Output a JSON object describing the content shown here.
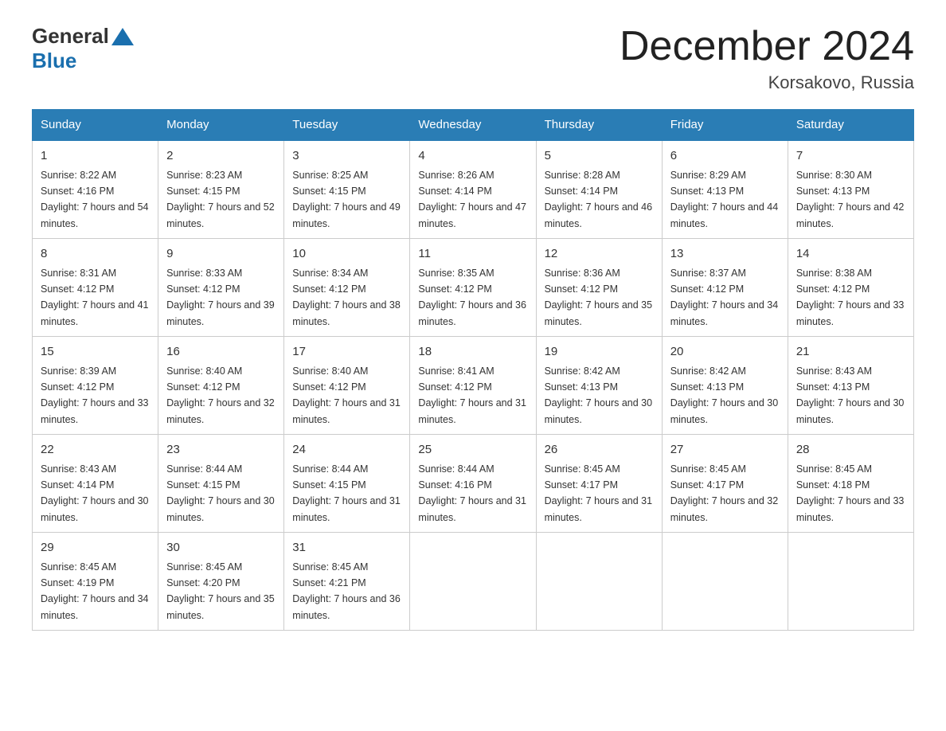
{
  "logo": {
    "general": "General",
    "blue": "Blue"
  },
  "title": "December 2024",
  "subtitle": "Korsakovo, Russia",
  "days_of_week": [
    "Sunday",
    "Monday",
    "Tuesday",
    "Wednesday",
    "Thursday",
    "Friday",
    "Saturday"
  ],
  "weeks": [
    [
      {
        "day": "1",
        "sunrise": "8:22 AM",
        "sunset": "4:16 PM",
        "daylight": "7 hours and 54 minutes."
      },
      {
        "day": "2",
        "sunrise": "8:23 AM",
        "sunset": "4:15 PM",
        "daylight": "7 hours and 52 minutes."
      },
      {
        "day": "3",
        "sunrise": "8:25 AM",
        "sunset": "4:15 PM",
        "daylight": "7 hours and 49 minutes."
      },
      {
        "day": "4",
        "sunrise": "8:26 AM",
        "sunset": "4:14 PM",
        "daylight": "7 hours and 47 minutes."
      },
      {
        "day": "5",
        "sunrise": "8:28 AM",
        "sunset": "4:14 PM",
        "daylight": "7 hours and 46 minutes."
      },
      {
        "day": "6",
        "sunrise": "8:29 AM",
        "sunset": "4:13 PM",
        "daylight": "7 hours and 44 minutes."
      },
      {
        "day": "7",
        "sunrise": "8:30 AM",
        "sunset": "4:13 PM",
        "daylight": "7 hours and 42 minutes."
      }
    ],
    [
      {
        "day": "8",
        "sunrise": "8:31 AM",
        "sunset": "4:12 PM",
        "daylight": "7 hours and 41 minutes."
      },
      {
        "day": "9",
        "sunrise": "8:33 AM",
        "sunset": "4:12 PM",
        "daylight": "7 hours and 39 minutes."
      },
      {
        "day": "10",
        "sunrise": "8:34 AM",
        "sunset": "4:12 PM",
        "daylight": "7 hours and 38 minutes."
      },
      {
        "day": "11",
        "sunrise": "8:35 AM",
        "sunset": "4:12 PM",
        "daylight": "7 hours and 36 minutes."
      },
      {
        "day": "12",
        "sunrise": "8:36 AM",
        "sunset": "4:12 PM",
        "daylight": "7 hours and 35 minutes."
      },
      {
        "day": "13",
        "sunrise": "8:37 AM",
        "sunset": "4:12 PM",
        "daylight": "7 hours and 34 minutes."
      },
      {
        "day": "14",
        "sunrise": "8:38 AM",
        "sunset": "4:12 PM",
        "daylight": "7 hours and 33 minutes."
      }
    ],
    [
      {
        "day": "15",
        "sunrise": "8:39 AM",
        "sunset": "4:12 PM",
        "daylight": "7 hours and 33 minutes."
      },
      {
        "day": "16",
        "sunrise": "8:40 AM",
        "sunset": "4:12 PM",
        "daylight": "7 hours and 32 minutes."
      },
      {
        "day": "17",
        "sunrise": "8:40 AM",
        "sunset": "4:12 PM",
        "daylight": "7 hours and 31 minutes."
      },
      {
        "day": "18",
        "sunrise": "8:41 AM",
        "sunset": "4:12 PM",
        "daylight": "7 hours and 31 minutes."
      },
      {
        "day": "19",
        "sunrise": "8:42 AM",
        "sunset": "4:13 PM",
        "daylight": "7 hours and 30 minutes."
      },
      {
        "day": "20",
        "sunrise": "8:42 AM",
        "sunset": "4:13 PM",
        "daylight": "7 hours and 30 minutes."
      },
      {
        "day": "21",
        "sunrise": "8:43 AM",
        "sunset": "4:13 PM",
        "daylight": "7 hours and 30 minutes."
      }
    ],
    [
      {
        "day": "22",
        "sunrise": "8:43 AM",
        "sunset": "4:14 PM",
        "daylight": "7 hours and 30 minutes."
      },
      {
        "day": "23",
        "sunrise": "8:44 AM",
        "sunset": "4:15 PM",
        "daylight": "7 hours and 30 minutes."
      },
      {
        "day": "24",
        "sunrise": "8:44 AM",
        "sunset": "4:15 PM",
        "daylight": "7 hours and 31 minutes."
      },
      {
        "day": "25",
        "sunrise": "8:44 AM",
        "sunset": "4:16 PM",
        "daylight": "7 hours and 31 minutes."
      },
      {
        "day": "26",
        "sunrise": "8:45 AM",
        "sunset": "4:17 PM",
        "daylight": "7 hours and 31 minutes."
      },
      {
        "day": "27",
        "sunrise": "8:45 AM",
        "sunset": "4:17 PM",
        "daylight": "7 hours and 32 minutes."
      },
      {
        "day": "28",
        "sunrise": "8:45 AM",
        "sunset": "4:18 PM",
        "daylight": "7 hours and 33 minutes."
      }
    ],
    [
      {
        "day": "29",
        "sunrise": "8:45 AM",
        "sunset": "4:19 PM",
        "daylight": "7 hours and 34 minutes."
      },
      {
        "day": "30",
        "sunrise": "8:45 AM",
        "sunset": "4:20 PM",
        "daylight": "7 hours and 35 minutes."
      },
      {
        "day": "31",
        "sunrise": "8:45 AM",
        "sunset": "4:21 PM",
        "daylight": "7 hours and 36 minutes."
      },
      null,
      null,
      null,
      null
    ]
  ]
}
